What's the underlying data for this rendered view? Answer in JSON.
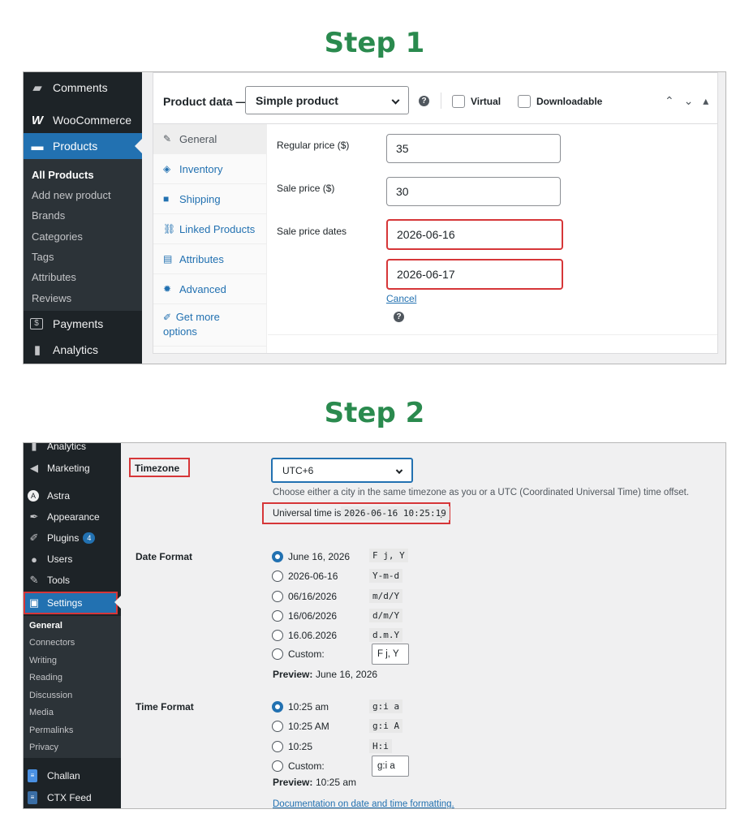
{
  "steps": {
    "step1": "Step 1",
    "step2": "Step 2"
  },
  "s1": {
    "sidebar": {
      "comments": "Comments",
      "woocommerce": "WooCommerce",
      "products": "Products",
      "submenu": [
        "All Products",
        "Add new product",
        "Brands",
        "Categories",
        "Tags",
        "Attributes",
        "Reviews"
      ],
      "payments": "Payments",
      "analytics": "Analytics"
    },
    "panel": {
      "title": "Product data —",
      "type_value": "Simple product",
      "help": "?",
      "virtual": "Virtual",
      "downloadable": "Downloadable",
      "controls": "⌃ ⌄ ▴"
    },
    "tabs": [
      "General",
      "Inventory",
      "Shipping",
      "Linked Products",
      "Attributes",
      "Advanced",
      "Get more",
      "options"
    ],
    "fields": {
      "regular_label": "Regular price ($)",
      "regular_value": "35",
      "sale_label": "Sale price ($)",
      "sale_value": "30",
      "dates_label": "Sale price dates",
      "date_from": "2026-06-16",
      "date_to": "2026-06-17",
      "cancel": "Cancel",
      "help": "?"
    }
  },
  "s2": {
    "sidebar": {
      "analytics": "Analytics",
      "marketing": "Marketing",
      "astra": "Astra",
      "appearance": "Appearance",
      "plugins": "Plugins",
      "plugins_badge": "4",
      "users": "Users",
      "tools": "Tools",
      "settings": "Settings",
      "submenu": [
        "General",
        "Connectors",
        "Writing",
        "Reading",
        "Discussion",
        "Media",
        "Permalinks",
        "Privacy"
      ],
      "challan": "Challan",
      "ctxfeed": "CTX Feed"
    },
    "timezone": {
      "label": "Timezone",
      "value": "UTC+6",
      "desc": "Choose either a city in the same timezone as you or a UTC (Coordinated Universal Time) time offset.",
      "universal_prefix": "Universal time is",
      "universal_value": "2026-06-16 10:25:19",
      "universal_suffix": "."
    },
    "date_format": {
      "label": "Date Format",
      "options": [
        {
          "text": "June 16, 2026",
          "code": "F j, Y"
        },
        {
          "text": "2026-06-16",
          "code": "Y-m-d"
        },
        {
          "text": "06/16/2026",
          "code": "m/d/Y"
        },
        {
          "text": "16/06/2026",
          "code": "d/m/Y"
        },
        {
          "text": "16.06.2026",
          "code": "d.m.Y"
        }
      ],
      "custom_label": "Custom:",
      "custom_value": "F j, Y",
      "preview_label": "Preview:",
      "preview_value": "June 16, 2026"
    },
    "time_format": {
      "label": "Time Format",
      "options": [
        {
          "text": "10:25 am",
          "code": "g:i a"
        },
        {
          "text": "10:25 AM",
          "code": "g:i A"
        },
        {
          "text": "10:25",
          "code": "H:i"
        }
      ],
      "custom_label": "Custom:",
      "custom_value": "g:i a",
      "preview_label": "Preview:",
      "preview_value": "10:25 am"
    },
    "doc_link": "Documentation on date and time formatting."
  }
}
